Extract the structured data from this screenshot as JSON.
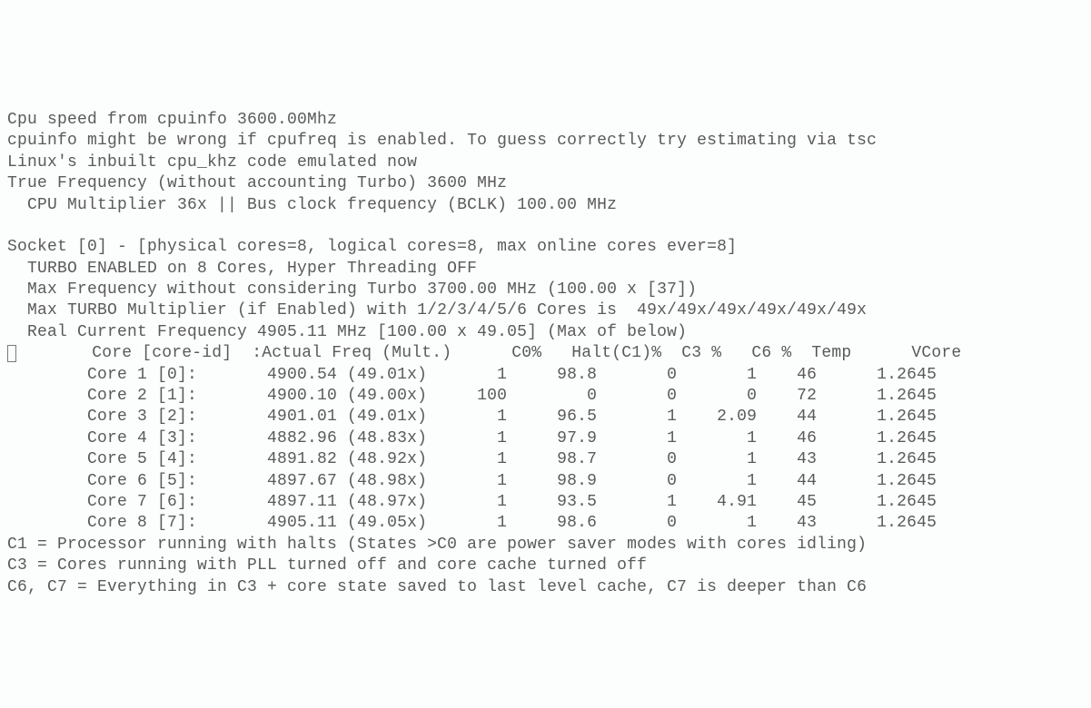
{
  "header": {
    "line1": "Cpu speed from cpuinfo 3600.00Mhz",
    "line2": "cpuinfo might be wrong if cpufreq is enabled. To guess correctly try estimating via tsc",
    "line3": "Linux's inbuilt cpu_khz code emulated now",
    "line4": "True Frequency (without accounting Turbo) 3600 MHz",
    "line5": "  CPU Multiplier 36x || Bus clock frequency (BCLK) 100.00 MHz"
  },
  "socket": {
    "line1": "Socket [0] - [physical cores=8, logical cores=8, max online cores ever=8]",
    "line2": "  TURBO ENABLED on 8 Cores, Hyper Threading OFF",
    "line3": "  Max Frequency without considering Turbo 3700.00 MHz (100.00 x [37])",
    "line4": "  Max TURBO Multiplier (if Enabled) with 1/2/3/4/5/6 Cores is  49x/49x/49x/49x/49x/49x",
    "line5": "  Real Current Frequency 4905.11 MHz [100.00 x 49.05] (Max of below)"
  },
  "table": {
    "header": "       Core [core-id]  :Actual Freq (Mult.)      C0%   Halt(C1)%  C3 %   C6 %  Temp      VCore",
    "rows": [
      "        Core 1 [0]:       4900.54 (49.01x)       1     98.8       0       1    46      1.2645",
      "        Core 2 [1]:       4900.10 (49.00x)     100        0       0       0    72      1.2645",
      "        Core 3 [2]:       4901.01 (49.01x)       1     96.5       1    2.09    44      1.2645",
      "        Core 4 [3]:       4882.96 (48.83x)       1     97.9       1       1    46      1.2645",
      "        Core 5 [4]:       4891.82 (48.92x)       1     98.7       0       1    43      1.2645",
      "        Core 6 [5]:       4897.67 (48.98x)       1     98.9       0       1    44      1.2645",
      "        Core 7 [6]:       4897.11 (48.97x)       1     93.5       1    4.91    45      1.2645",
      "        Core 8 [7]:       4905.11 (49.05x)       1     98.6       0       1    43      1.2645"
    ]
  },
  "footer": {
    "line1": "C1 = Processor running with halts (States >C0 are power saver modes with cores idling)",
    "line2": "C3 = Cores running with PLL turned off and core cache turned off",
    "line3": "C6, C7 = Everything in C3 + core state saved to last level cache, C7 is deeper than C6"
  },
  "chart_data": {
    "type": "table",
    "title": "i7z CPU core status",
    "cpu_speed_mhz": 3600.0,
    "true_frequency_mhz": 3600,
    "cpu_multiplier": 36,
    "bus_clock_mhz": 100.0,
    "socket_id": 0,
    "physical_cores": 8,
    "logical_cores": 8,
    "max_online_cores": 8,
    "turbo_enabled": true,
    "hyper_threading": false,
    "max_freq_no_turbo_mhz": 3700.0,
    "max_freq_no_turbo_mult": 37,
    "max_turbo_multipliers": [
      49,
      49,
      49,
      49,
      49,
      49
    ],
    "real_current_frequency_mhz": 4905.11,
    "real_current_mult": 49.05,
    "columns": [
      "core",
      "core_id",
      "actual_freq_mhz",
      "mult",
      "C0_pct",
      "Halt_C1_pct",
      "C3_pct",
      "C6_pct",
      "temp_c",
      "vcore"
    ],
    "rows": [
      {
        "core": 1,
        "core_id": 0,
        "actual_freq_mhz": 4900.54,
        "mult": 49.01,
        "C0_pct": 1,
        "Halt_C1_pct": 98.8,
        "C3_pct": 0,
        "C6_pct": 1,
        "temp_c": 46,
        "vcore": 1.2645
      },
      {
        "core": 2,
        "core_id": 1,
        "actual_freq_mhz": 4900.1,
        "mult": 49.0,
        "C0_pct": 100,
        "Halt_C1_pct": 0,
        "C3_pct": 0,
        "C6_pct": 0,
        "temp_c": 72,
        "vcore": 1.2645
      },
      {
        "core": 3,
        "core_id": 2,
        "actual_freq_mhz": 4901.01,
        "mult": 49.01,
        "C0_pct": 1,
        "Halt_C1_pct": 96.5,
        "C3_pct": 1,
        "C6_pct": 2.09,
        "temp_c": 44,
        "vcore": 1.2645
      },
      {
        "core": 4,
        "core_id": 3,
        "actual_freq_mhz": 4882.96,
        "mult": 48.83,
        "C0_pct": 1,
        "Halt_C1_pct": 97.9,
        "C3_pct": 1,
        "C6_pct": 1,
        "temp_c": 46,
        "vcore": 1.2645
      },
      {
        "core": 5,
        "core_id": 4,
        "actual_freq_mhz": 4891.82,
        "mult": 48.92,
        "C0_pct": 1,
        "Halt_C1_pct": 98.7,
        "C3_pct": 0,
        "C6_pct": 1,
        "temp_c": 43,
        "vcore": 1.2645
      },
      {
        "core": 6,
        "core_id": 5,
        "actual_freq_mhz": 4897.67,
        "mult": 48.98,
        "C0_pct": 1,
        "Halt_C1_pct": 98.9,
        "C3_pct": 0,
        "C6_pct": 1,
        "temp_c": 44,
        "vcore": 1.2645
      },
      {
        "core": 7,
        "core_id": 6,
        "actual_freq_mhz": 4897.11,
        "mult": 48.97,
        "C0_pct": 1,
        "Halt_C1_pct": 93.5,
        "C3_pct": 1,
        "C6_pct": 4.91,
        "temp_c": 45,
        "vcore": 1.2645
      },
      {
        "core": 8,
        "core_id": 7,
        "actual_freq_mhz": 4905.11,
        "mult": 49.05,
        "C0_pct": 1,
        "Halt_C1_pct": 98.6,
        "C3_pct": 0,
        "C6_pct": 1,
        "temp_c": 43,
        "vcore": 1.2645
      }
    ]
  }
}
